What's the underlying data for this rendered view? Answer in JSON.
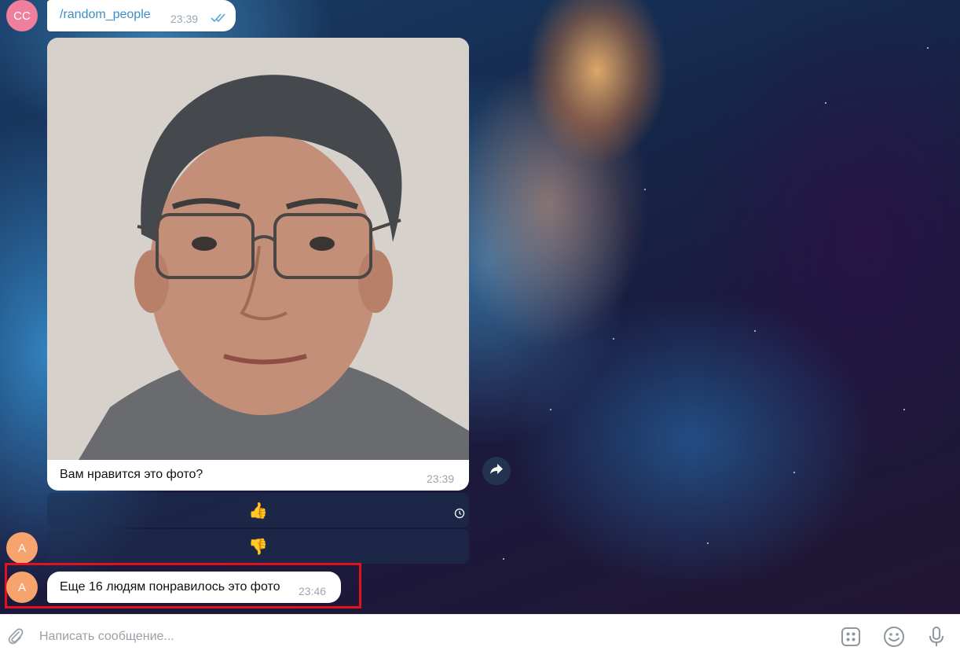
{
  "chat": {
    "outgoing_message": {
      "avatar_initials": "CC",
      "text": "/random_people",
      "time": "23:39",
      "status": "read-double-check-icon"
    },
    "photo_message": {
      "caption": "Вам нравится это фото?",
      "time": "23:39"
    },
    "reply_keyboard": [
      {
        "label": "👍",
        "icon": "thumbs-up-icon"
      },
      {
        "label": "👎",
        "icon": "thumbs-down-icon"
      }
    ],
    "incoming_avatar_initials": "A",
    "incoming_message": {
      "avatar_initials": "A",
      "text": "Еще 16 людям понравилось это фото",
      "time": "23:46"
    }
  },
  "composer": {
    "placeholder": "Написать сообщение..."
  },
  "colors": {
    "avatar_cc": "#f07f9c",
    "avatar_a": "#f6a36e",
    "link_text": "#3a8ec9",
    "highlight": "#e0121b"
  }
}
